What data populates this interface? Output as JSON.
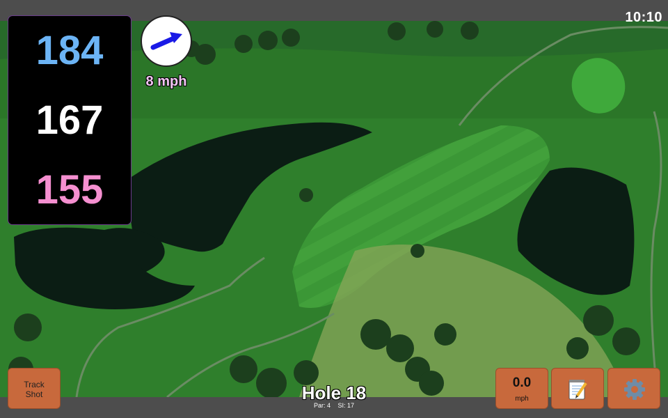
{
  "status_bar": {
    "time": "10:10"
  },
  "distances": {
    "back": "184",
    "middle": "167",
    "front": "155",
    "colors": {
      "back": "#6cb4f5",
      "middle": "#ffffff",
      "front": "#f58fd0"
    }
  },
  "wind": {
    "speed_label": "8 mph",
    "direction_icon": "arrow-east-northeast",
    "arrow_color": "#1a1ae6",
    "label_color": "#f3c6f4"
  },
  "hole": {
    "title": "Hole 18",
    "par_label": "Par: 4",
    "si_label": "SI: 17"
  },
  "buttons": {
    "track_shot_line1": "Track",
    "track_shot_line2": "Shot",
    "speed_value": "0.0",
    "speed_unit": "mph",
    "notes_icon": "notepad-pencil-icon",
    "settings_icon": "gear-icon",
    "accent_color": "#c8693c"
  },
  "map": {
    "type": "satellite-aerial-golf-hole",
    "features": [
      "water-hazard-left",
      "water-hazard-right",
      "fairway",
      "green",
      "cart-paths",
      "trees"
    ]
  }
}
